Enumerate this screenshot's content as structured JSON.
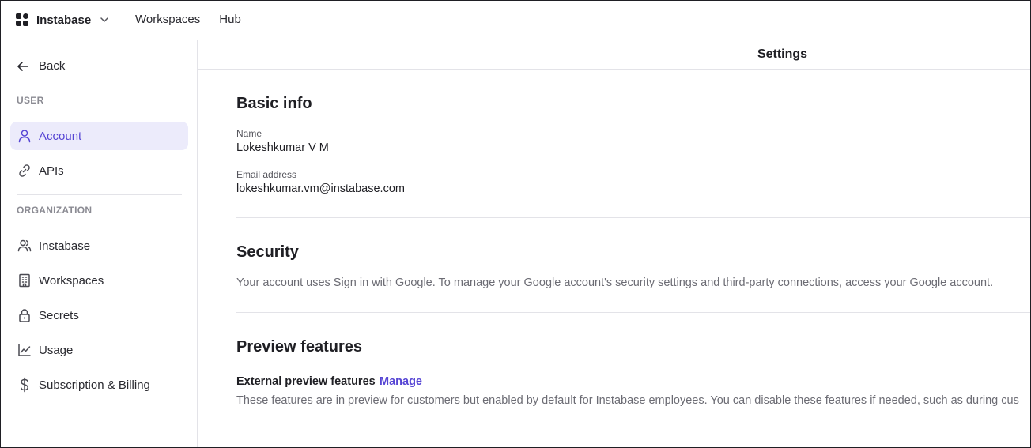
{
  "topbar": {
    "brand_name": "Instabase",
    "nav": [
      "Workspaces",
      "Hub"
    ]
  },
  "sidebar": {
    "back_label": "Back",
    "user_section_label": "USER",
    "user_items": [
      {
        "label": "Account",
        "icon": "user-icon",
        "active": true
      },
      {
        "label": "APIs",
        "icon": "link-icon",
        "active": false
      }
    ],
    "org_section_label": "ORGANIZATION",
    "org_items": [
      {
        "label": "Instabase",
        "icon": "users-icon"
      },
      {
        "label": "Workspaces",
        "icon": "building-icon"
      },
      {
        "label": "Secrets",
        "icon": "lock-icon"
      },
      {
        "label": "Usage",
        "icon": "chart-line-icon"
      },
      {
        "label": "Subscription & Billing",
        "icon": "dollar-icon"
      }
    ]
  },
  "main": {
    "page_title": "Settings",
    "basic_info": {
      "heading": "Basic info",
      "name_label": "Name",
      "name_value": "Lokeshkumar V M",
      "email_label": "Email address",
      "email_value": "lokeshkumar.vm@instabase.com"
    },
    "security": {
      "heading": "Security",
      "description": "Your account uses Sign in with Google. To manage your Google account's security settings and third-party connections, access your Google account."
    },
    "preview": {
      "heading": "Preview features",
      "label": "External preview features",
      "manage_label": "Manage",
      "description": "These features are in preview for customers but enabled by default for Instabase employees. You can disable these features if needed, such as during cus"
    }
  },
  "colors": {
    "accent": "#5645d4",
    "active_bg": "#ecebfb",
    "border": "#e3e3e8",
    "muted_text": "#6c6c74"
  }
}
